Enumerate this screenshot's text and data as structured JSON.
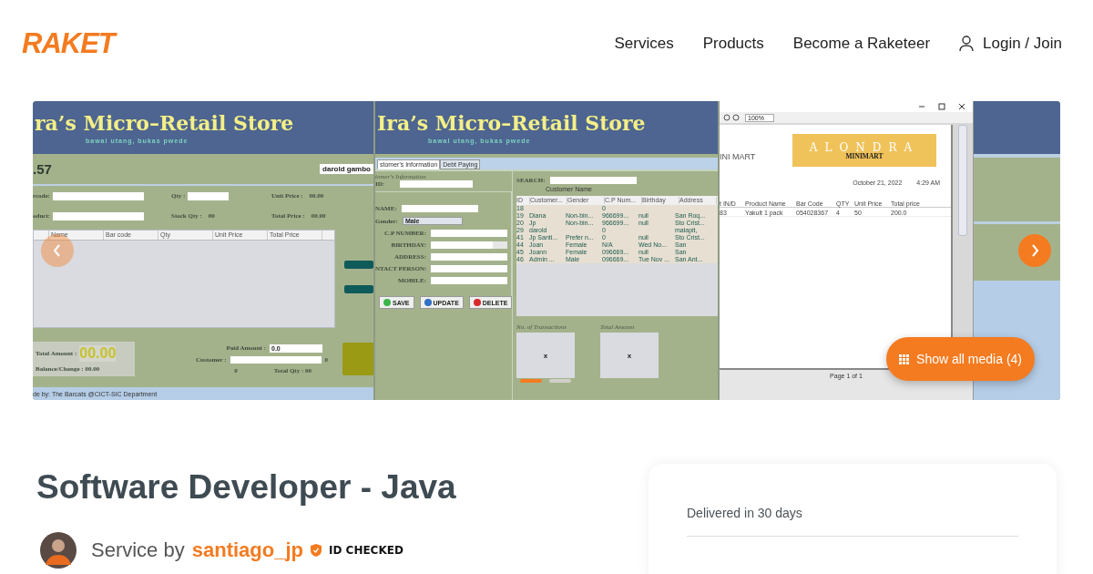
{
  "header": {
    "logo": "RAKET",
    "nav": [
      {
        "label": "Services"
      },
      {
        "label": "Products"
      },
      {
        "label": "Become a Raketeer"
      }
    ],
    "login": "Login / Join"
  },
  "gallery": {
    "slides": [
      {
        "kind": "pos",
        "title": "ra’s Micro–Retail Store",
        "tagline": "bawal utang, bukas pwede",
        "clock": ".57",
        "user": "darold gambo",
        "form": [
          {
            "kind": "input",
            "label": "rcode:"
          },
          {
            "kind": "input",
            "label": "Qty :"
          },
          {
            "kind": "readout",
            "label": "Unit Price :",
            "value": "00.00"
          },
          {
            "kind": "input",
            "label": "oduct:"
          },
          {
            "kind": "readout",
            "label": "Stock Qty :",
            "value": "00"
          },
          {
            "kind": "readout",
            "label": "Total Price :",
            "value": "00.00"
          }
        ],
        "columns": [
          "Name",
          "Bar code",
          "Qty",
          "Unit Price",
          "Total Price"
        ],
        "total_label": "Total Amount :",
        "total": "00.00",
        "balance": "Balance/Change : 00.00",
        "paid_label": "Paid Amount :",
        "paid": "0.0",
        "customer_label": "Customer :",
        "customer_count": "0",
        "count": "0",
        "total_qty": "Total Qty : 00",
        "footer": "de by: The Barcats @CICT-SIC Department"
      },
      {
        "kind": "customers",
        "title": "Ira’s Micro–Retail Store",
        "tagline": "bawal utang, bukas pwede",
        "tabs": [
          {
            "label": "stomer's Information",
            "selected": true
          },
          {
            "label": "Debt Paying",
            "selected": false
          }
        ],
        "section": "tomer's Information",
        "id_label": "ID:",
        "fields": [
          {
            "kind": "input",
            "label": "NAME:"
          },
          {
            "kind": "select",
            "label": "Gender:",
            "value": "Male"
          },
          {
            "kind": "input",
            "label": "C.P NUMBER:"
          },
          {
            "kind": "date",
            "label": "BIRTHDAY:"
          },
          {
            "kind": "input",
            "label": "ADDRESS:"
          },
          {
            "kind": "input",
            "label": "NTACT PERSON:"
          },
          {
            "kind": "input",
            "label": "MOBILE:"
          }
        ],
        "buttons": [
          {
            "kind": "save",
            "label": "SAVE"
          },
          {
            "kind": "update",
            "label": "UPDATE"
          },
          {
            "kind": "delete",
            "label": "DELETE"
          }
        ],
        "search_label": "SEARCH:",
        "search_hint": "Customer Name",
        "columns": [
          "ID",
          "Customer...",
          "Gender",
          "C.P Num...",
          "Birthday",
          "Address"
        ],
        "rows": [
          [
            "18",
            null,
            null,
            "0",
            null,
            null
          ],
          [
            "19",
            "Diana",
            "Non-bin...",
            "966699...",
            "null",
            "San Roq..."
          ],
          [
            "20",
            "Jp",
            "Non-bin...",
            "966699...",
            "null",
            "Sto Crist..."
          ],
          [
            "29",
            "darold",
            null,
            "0",
            null,
            "malapit,"
          ],
          [
            "41",
            "Jp Santi...",
            "Prefer n...",
            "0",
            "null",
            "Sto Crist..."
          ],
          [
            "44",
            "Joan",
            "Female",
            "N/A",
            "Wed No...",
            "San"
          ],
          [
            "45",
            "Joann",
            "Female",
            "096669...",
            "null",
            "San"
          ],
          [
            "46",
            "Admin ...",
            "Male",
            "096669...",
            "Tue Nov ...",
            "San Ant..."
          ]
        ],
        "stats": [
          {
            "label": "No. of Transactions",
            "value": "x"
          },
          {
            "label": "Total Amount",
            "value": "x"
          }
        ]
      },
      {
        "kind": "receipt",
        "zoom": "100%",
        "logo_title": "ALONDRA",
        "logo_sub": "MINIMART",
        "store": "INI MART",
        "date": "October 21, 2022",
        "time": "4:29 AM",
        "columns": [
          "t IN/D",
          "Product Name",
          "Bar Code",
          "QTY",
          "Unit Price",
          "Total price"
        ],
        "rows": [
          [
            "83",
            "Yakult 1 pack",
            "054028367",
            "4",
            "50",
            "200.0"
          ]
        ],
        "page": "Page 1 of 1"
      }
    ],
    "dots": [
      {
        "selected": true
      },
      {
        "selected": false
      }
    ],
    "show_all": "Show all media (4)"
  },
  "service": {
    "title": "Software Developer - Java",
    "by": "Service by",
    "seller": "santiago_jp",
    "badge": "ID CHECKED"
  },
  "card": {
    "delivery": "Delivered in 30 days"
  }
}
